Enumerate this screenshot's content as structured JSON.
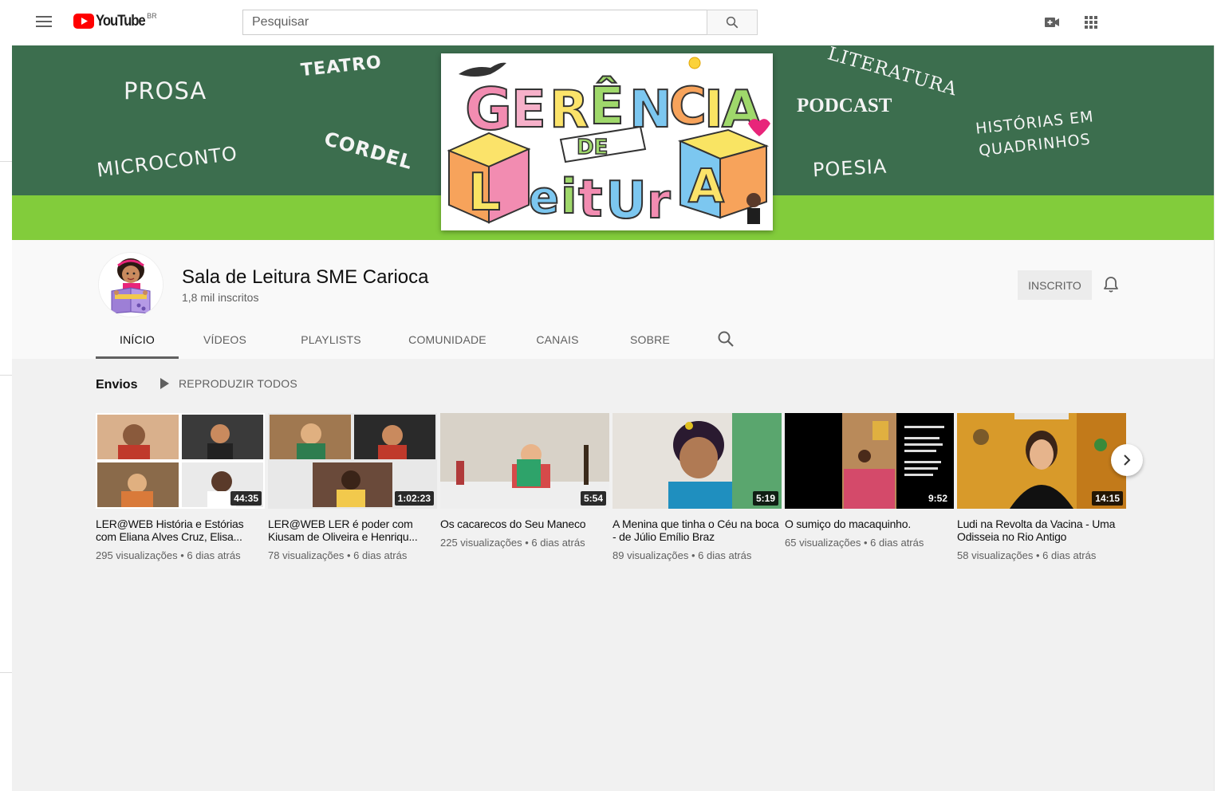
{
  "topbar": {
    "logo_text": "YouTube",
    "country": "BR",
    "search_placeholder": "Pesquisar",
    "search_value": "",
    "icons": [
      "menu-icon",
      "search-icon",
      "create-video-icon",
      "apps-grid-icon"
    ]
  },
  "banner": {
    "words": [
      "PROSA",
      "TEATRO",
      "MICROCONTO",
      "CORDEL",
      "LITERATURA",
      "PODCAST",
      "HISTÓRIAS EM",
      "QUADRINHOS",
      "POESIA"
    ],
    "art_title": "GERÊNCIA DE LEITURA",
    "colors": {
      "dark_green": "#3c6e4e",
      "light_green": "#82cc3b"
    }
  },
  "channel": {
    "name": "Sala de Leitura SME Carioca",
    "subscribers": "1,8 mil inscritos",
    "subscribe_label": "INSCRITO"
  },
  "tabs": [
    {
      "label": "INÍCIO",
      "active": true
    },
    {
      "label": "VÍDEOS",
      "active": false
    },
    {
      "label": "PLAYLISTS",
      "active": false
    },
    {
      "label": "COMUNIDADE",
      "active": false
    },
    {
      "label": "CANAIS",
      "active": false
    },
    {
      "label": "SOBRE",
      "active": false
    }
  ],
  "shelf": {
    "title": "Envios",
    "play_all": "REPRODUZIR TODOS",
    "videos": [
      {
        "title": "LER@WEB História e Estórias com Eliana Alves Cruz, Elisa...",
        "duration": "44:35",
        "meta": "295 visualizações • 6 dias atrás"
      },
      {
        "title": "LER@WEB LER é poder com Kiusam de Oliveira e Henriqu...",
        "duration": "1:02:23",
        "meta": "78 visualizações • 6 dias atrás"
      },
      {
        "title": "Os cacarecos do Seu Maneco",
        "duration": "5:54",
        "meta": "225 visualizações • 6 dias atrás"
      },
      {
        "title": "A Menina que tinha o Céu na boca - de Júlio Emílio Braz",
        "duration": "5:19",
        "meta": "89 visualizações • 6 dias atrás"
      },
      {
        "title": "O sumiço do macaquinho.",
        "duration": "9:52",
        "meta": "65 visualizações • 6 dias atrás"
      },
      {
        "title": "Ludi na Revolta da Vacina - Uma Odisseia no Rio Antigo",
        "duration": "14:15",
        "meta": "58 visualizações • 6 dias atrás"
      }
    ]
  }
}
